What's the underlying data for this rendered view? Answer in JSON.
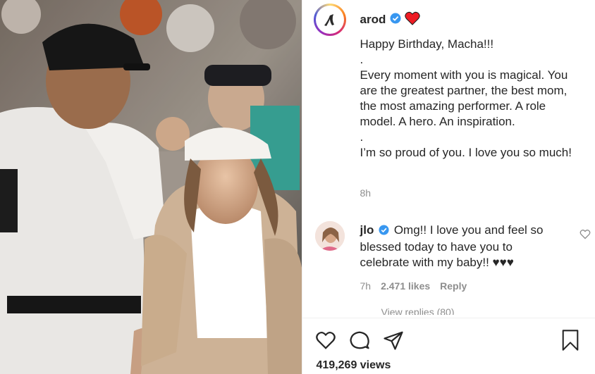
{
  "post": {
    "username": "arod",
    "verified": true,
    "caption_lines": [
      "Happy Birthday, Macha!!!",
      ".",
      "Every moment with you is magical. You are the greatest partner, the best mom, the most amazing performer. A role model. A hero. An inspiration.",
      ".",
      "I’m so proud of you. I love you so much!"
    ],
    "time": "8h",
    "views": "419,269 views"
  },
  "comment": {
    "username": "jlo",
    "text": "Omg!! I love you and feel so blessed today to have you to celebrate with my baby!! ♥♥♥",
    "time": "7h",
    "likes": "2.471 likes",
    "reply_label": "Reply",
    "view_replies": "View replies (80)"
  },
  "icons": {
    "verified": "verified-badge-icon",
    "heart_emoji": "red-heart-emoji",
    "like": "heart-outline-icon",
    "comment": "comment-icon",
    "share": "paper-plane-icon",
    "save": "bookmark-icon",
    "comment_like": "small-heart-icon"
  },
  "colors": {
    "verified_blue": "#3897f0",
    "heart_red": "#ed1c24",
    "muted_text": "#8e8e8e"
  }
}
